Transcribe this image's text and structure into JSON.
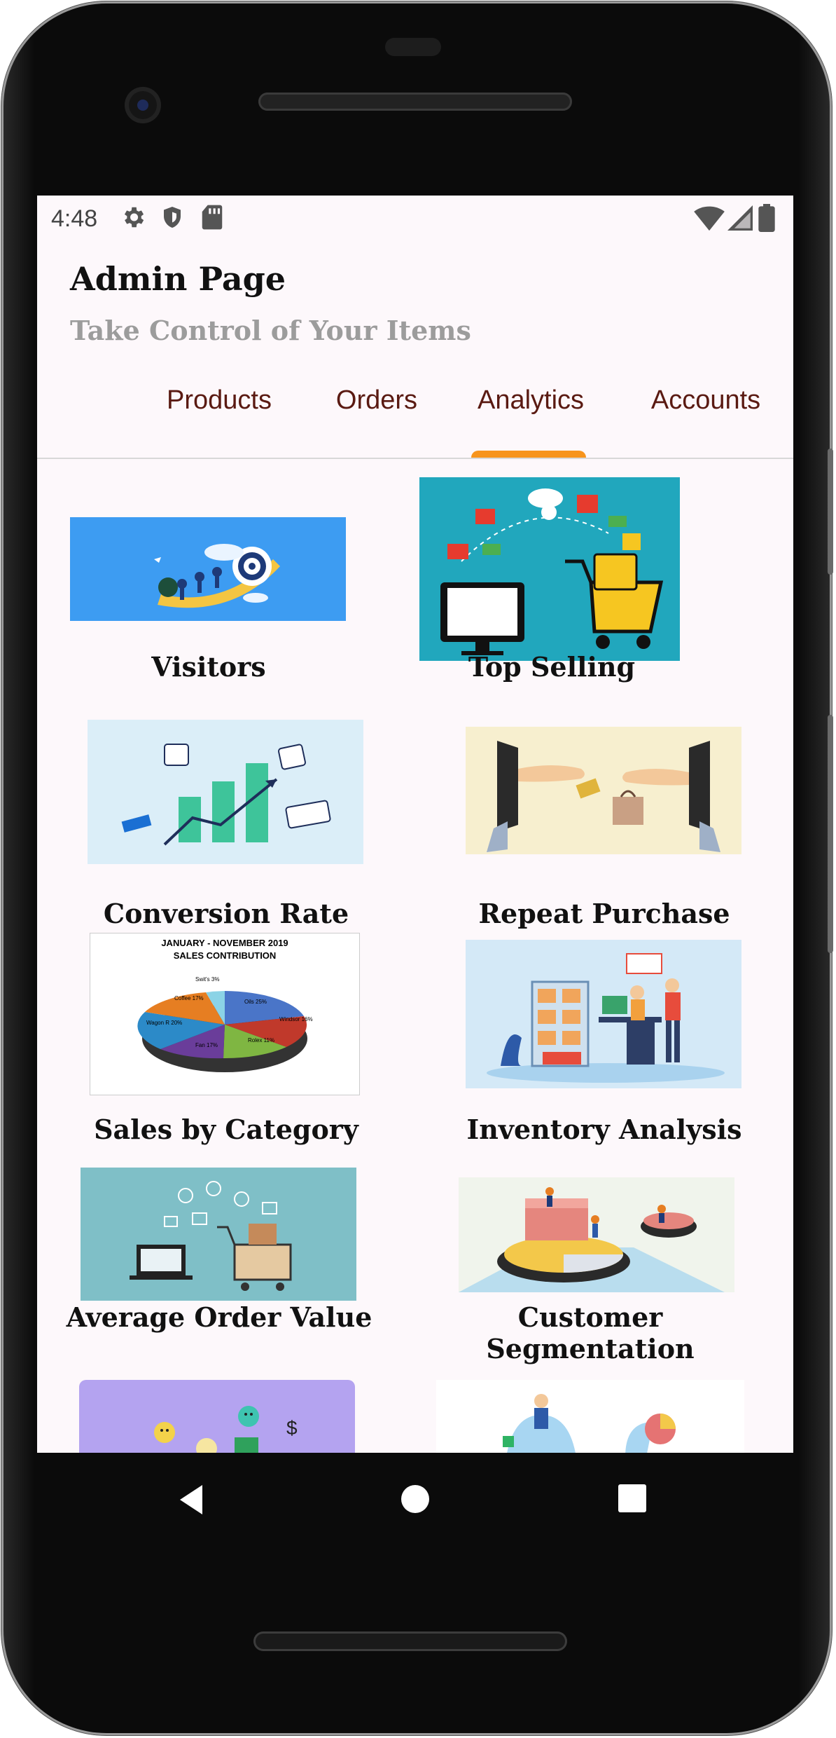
{
  "status_bar": {
    "time": "4:48"
  },
  "header": {
    "title": "Admin Page",
    "subtitle": "Take Control of Your Items"
  },
  "tabs": [
    {
      "label": "Products"
    },
    {
      "label": "Orders"
    },
    {
      "label": "Analytics",
      "selected": true
    },
    {
      "label": "Accounts"
    }
  ],
  "accent_color": "#f7941d",
  "tab_text_color": "#5a1a12",
  "cards": [
    {
      "label": "Visitors",
      "illustration": "target-arrow-icon"
    },
    {
      "label": "Top Selling",
      "illustration": "shopping-cart-icon"
    },
    {
      "label": "Conversion Rate",
      "illustration": "bar-chart-icon"
    },
    {
      "label": "Repeat Purchase",
      "illustration": "monitor-exchange-icon"
    },
    {
      "label": "Sales by Category",
      "illustration": "pie-chart-icon",
      "chart_text": {
        "title": "JANUARY - NOVEMBER 2019",
        "subtitle": "SALES CONTRIBUTION",
        "slices": [
          "Swit's 3%",
          "Coffee 17%",
          "Wagon R 20%",
          "Fan 17%",
          "Rolex 11%",
          "Windsor 16%",
          "Oils 25%"
        ]
      }
    },
    {
      "label": "Inventory Analysis",
      "illustration": "warehouse-icon"
    },
    {
      "label": "Average Order Value",
      "illustration": "laptop-cart-icon"
    },
    {
      "label": "Customer Segmentation",
      "illustration": "segments-icon"
    },
    {
      "label": "",
      "illustration": "smiley-icon"
    },
    {
      "label": "",
      "illustration": "analytics-people-icon"
    }
  ],
  "nav": {
    "back": "back-icon",
    "home": "home-icon",
    "recents": "recents-icon"
  }
}
